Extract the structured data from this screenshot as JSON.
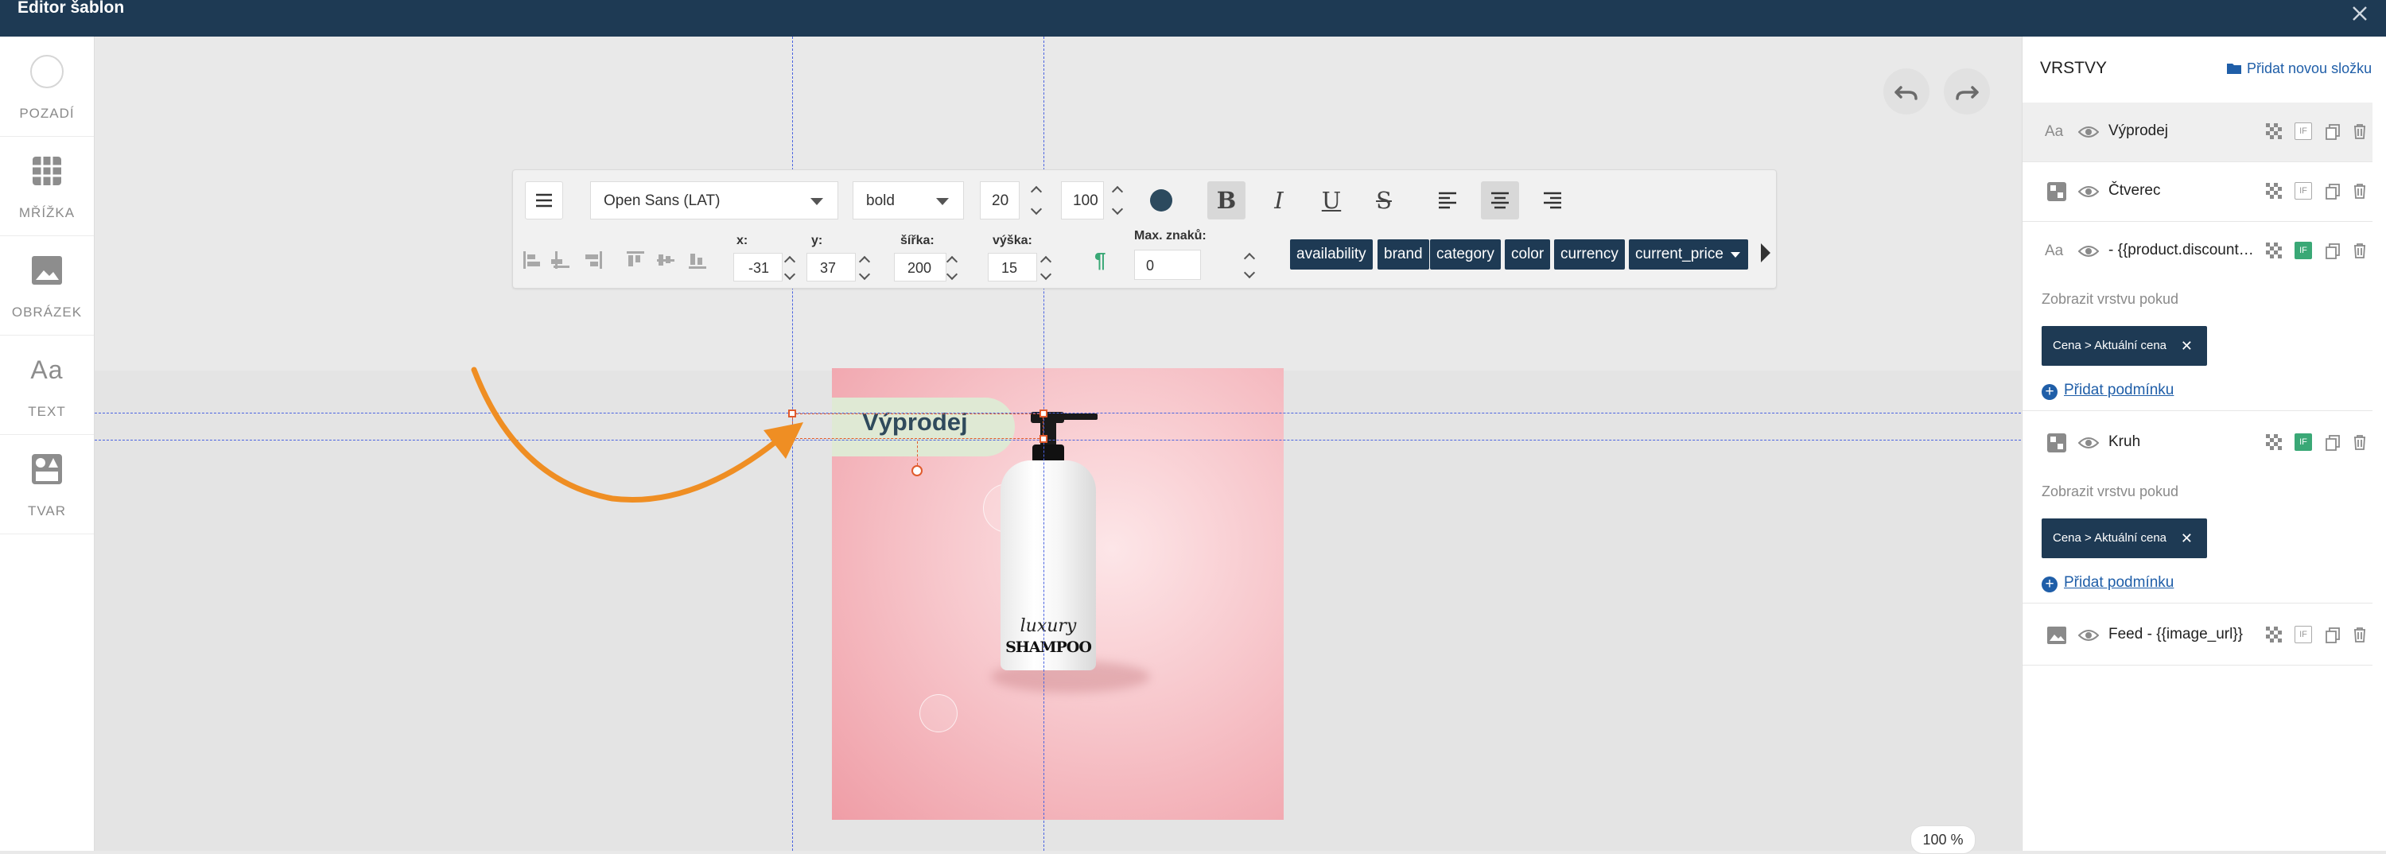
{
  "window": {
    "title": "Editor šablon"
  },
  "tools": [
    {
      "label": "POZADÍ",
      "icon": "circle-icon"
    },
    {
      "label": "MŘÍŽKA",
      "icon": "grid-icon"
    },
    {
      "label": "OBRÁZEK",
      "icon": "image-icon"
    },
    {
      "label": "TEXT",
      "icon": "text-icon",
      "glyph": "Aa"
    },
    {
      "label": "TVAR",
      "icon": "shapes-icon"
    }
  ],
  "toolbar": {
    "font_family": "Open Sans (LAT)",
    "font_weight": "bold",
    "font_size": "20",
    "opacity": "100",
    "text_color": "#2c4a5e",
    "bold": "B",
    "italic": "I",
    "underline": "U",
    "strike": "S",
    "fields": {
      "x_label": "x:",
      "x": "-31",
      "y_label": "y:",
      "y": "37",
      "width_label": "šířka:",
      "width": "200",
      "height_label": "výška:",
      "height": "15",
      "max_label": "Max. znaků:",
      "max": "0"
    },
    "tags": [
      "availability",
      "brand",
      "category",
      "color",
      "currency",
      "current_price"
    ]
  },
  "canvas": {
    "label_text": "Výprodej",
    "product_script": "luxury",
    "product_name": "SHAMPOO",
    "zoom": "100 %"
  },
  "panel": {
    "title": "VRSTVY",
    "add_folder": "Přidat novou složku",
    "layers": [
      {
        "type_glyph": "Aa",
        "name": "Výprodej",
        "if_active": false
      },
      {
        "type_glyph": "shape",
        "name": "Čtverec",
        "if_active": false
      },
      {
        "type_glyph": "Aa",
        "name": "- {{product.discount…",
        "if_active": true
      },
      {
        "type_glyph": "shape",
        "name": "Kruh",
        "if_active": true
      },
      {
        "type_glyph": "image",
        "name": "Feed - {{image_url}}",
        "if_active": false
      }
    ],
    "show_if_label": "Zobrazit vrstvu pokud",
    "condition": "Cena > Aktuální cena",
    "add_condition": "Přidat podmínku",
    "if_badge": "IF"
  },
  "colors": {
    "header": "#1e3a54",
    "tag": "#1e3a54",
    "accent_orange": "#ef8e23",
    "guide": "#4a63e0",
    "if_green": "#3aa876"
  }
}
